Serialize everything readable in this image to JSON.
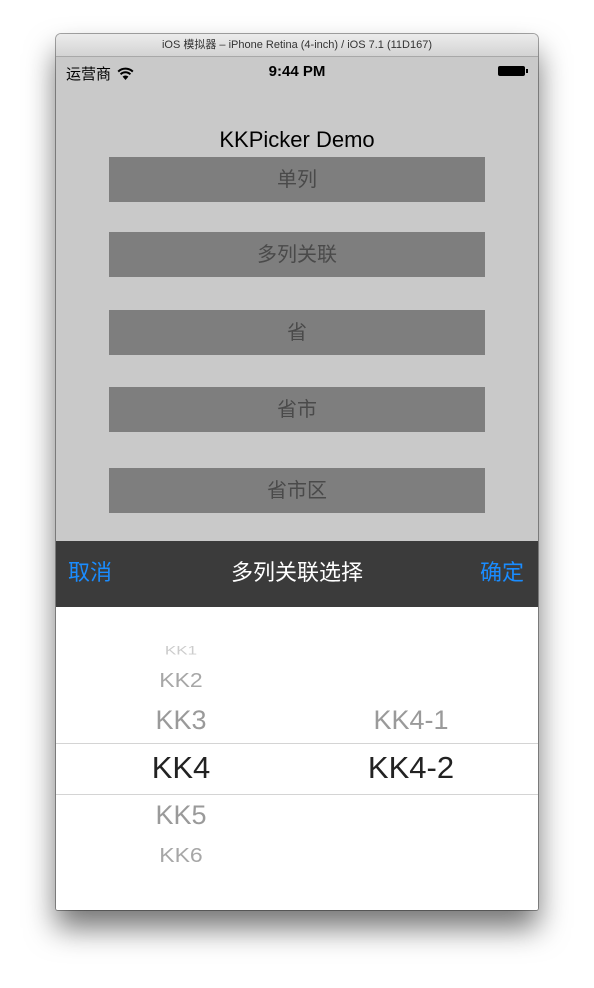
{
  "window": {
    "title": "iOS 模拟器 – iPhone Retina (4-inch) / iOS 7.1 (11D167)"
  },
  "statusbar": {
    "carrier": "运营商",
    "time": "9:44 PM",
    "icons": [
      "wifi-icon",
      "battery-icon"
    ]
  },
  "nav": {
    "title": "KKPicker Demo"
  },
  "menu": {
    "items": [
      {
        "label": "单列"
      },
      {
        "label": "多列关联"
      },
      {
        "label": "省"
      },
      {
        "label": "省市"
      },
      {
        "label": "省市区"
      }
    ]
  },
  "toolbar": {
    "cancel": "取消",
    "title": "多列关联选择",
    "confirm": "确定"
  },
  "picker": {
    "column1": {
      "items": [
        "KK1",
        "KK2",
        "KK3",
        "KK4",
        "KK5",
        "KK6"
      ],
      "selected": "KK4"
    },
    "column2": {
      "items": [
        "KK4-1",
        "KK4-2"
      ],
      "selected": "KK4-2"
    }
  },
  "colors": {
    "accent": "#1a8cff",
    "toolbar": "#3b3b3b",
    "screen_bg": "#c9c9c9",
    "button_bg": "#7e7e7e"
  }
}
